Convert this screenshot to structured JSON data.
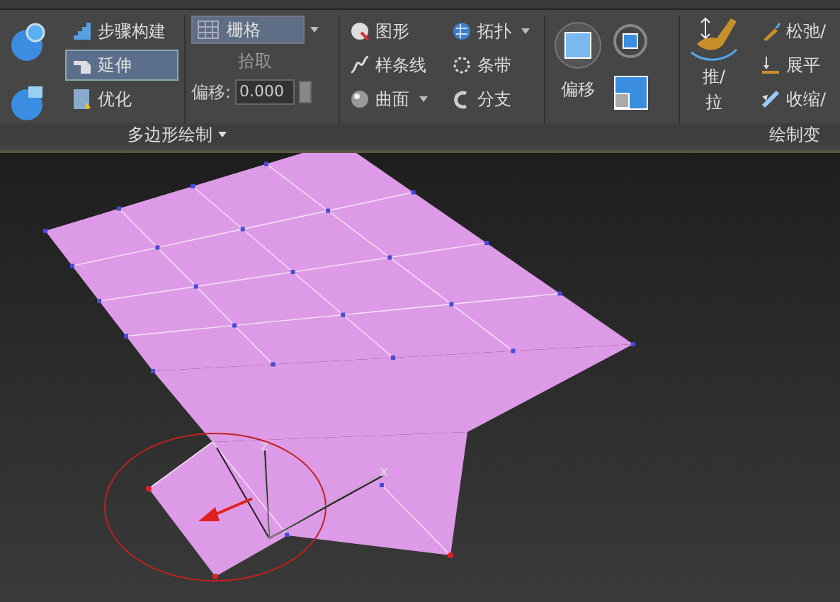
{
  "ribbon": {
    "columns": [
      {
        "kind": "bigicons"
      },
      {
        "kind": "list",
        "items": [
          {
            "label": "步骤构建",
            "selected": false
          },
          {
            "label": "延伸",
            "selected": true
          },
          {
            "label": "优化",
            "selected": false
          }
        ]
      },
      {
        "kind": "grid",
        "dropdown": {
          "value": "栅格"
        },
        "pick": {
          "label": "拾取",
          "disabled": true
        },
        "offset": {
          "label": "偏移:",
          "value": "0.000"
        }
      },
      {
        "kind": "list",
        "items": [
          {
            "label": "图形",
            "selected": false,
            "menu": false
          },
          {
            "label": "样条线",
            "selected": false,
            "menu": false
          },
          {
            "label": "曲面",
            "selected": false,
            "menu": true
          }
        ]
      },
      {
        "kind": "list",
        "items": [
          {
            "label": "拓扑",
            "selected": false,
            "menu": true
          },
          {
            "label": "条带",
            "selected": false,
            "menu": false
          },
          {
            "label": "分支",
            "selected": false,
            "menu": false
          }
        ]
      },
      {
        "kind": "sep"
      },
      {
        "kind": "move",
        "label": "偏移"
      },
      {
        "kind": "sep"
      },
      {
        "kind": "push",
        "label": "推/\n拉"
      },
      {
        "kind": "list",
        "items": [
          {
            "label": "松弛/",
            "selected": false
          },
          {
            "label": "展平",
            "selected": false
          },
          {
            "label": "收缩/",
            "selected": false
          }
        ]
      }
    ],
    "panel_titles": [
      {
        "label": "多边形绘制",
        "menu": true
      },
      {
        "label": "绘制变",
        "menu": false
      }
    ]
  },
  "viewport": {
    "gizmo_labels": [
      "z",
      "x"
    ]
  }
}
